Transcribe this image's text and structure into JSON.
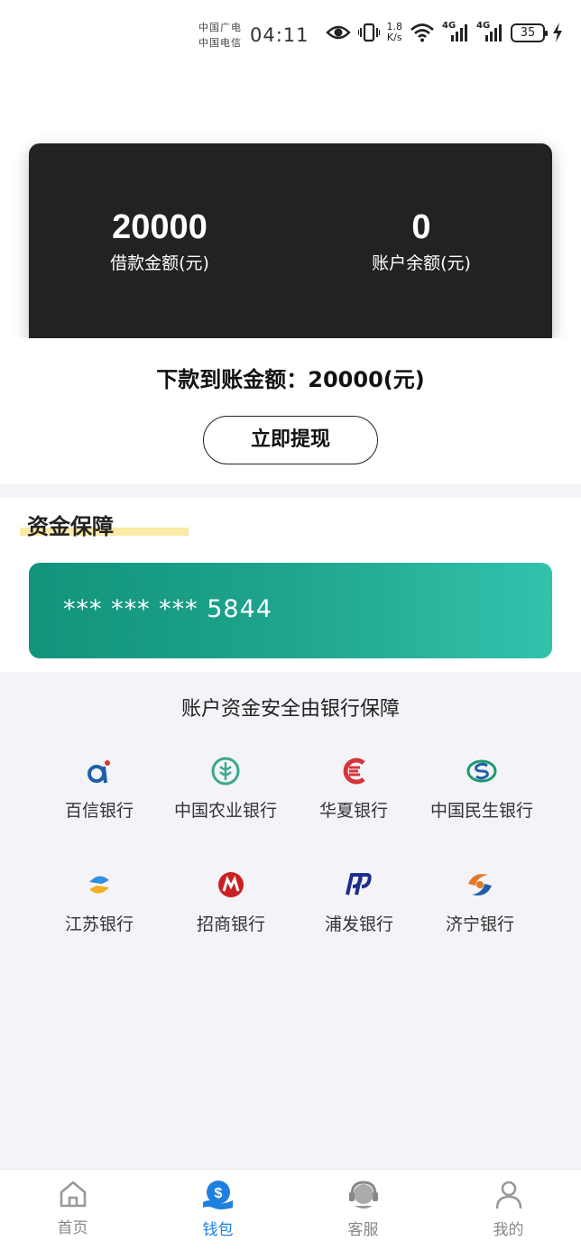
{
  "status_bar": {
    "carrier_1": "中国广电",
    "carrier_2": "中国电信",
    "time": "04:11",
    "net_speed_value": "1.8",
    "net_speed_unit": "K/s",
    "signal_1_label": "4G",
    "signal_2_label": "4G",
    "battery": "35",
    "icons": [
      "eye-icon",
      "vibrate-icon",
      "wifi-icon",
      "signal-icon",
      "signal-icon",
      "battery-icon",
      "charging-icon"
    ]
  },
  "summary": {
    "loan_amount": "20000",
    "loan_amount_label": "借款金额(元)",
    "balance": "0",
    "balance_label": "账户余额(元)"
  },
  "disbursement": {
    "text": "下款到账金额：20000(元)",
    "withdraw_button": "立即提现"
  },
  "fund_protection": {
    "title": "资金保障",
    "card_number": "*** *** *** 5844",
    "guarantee_text": "账户资金安全由银行保障"
  },
  "banks": [
    {
      "name": "百信银行",
      "icon": "aibank-logo-icon",
      "color": "#1f5fa8"
    },
    {
      "name": "中国农业银行",
      "icon": "abc-logo-icon",
      "color": "#3aa88d"
    },
    {
      "name": "华夏银行",
      "icon": "hxb-logo-icon",
      "color": "#d8343a"
    },
    {
      "name": "中国民生银行",
      "icon": "cmbc-logo-icon",
      "color": "#1a9a6e"
    },
    {
      "name": "江苏银行",
      "icon": "jsb-logo-icon",
      "color": "#2f8fe0"
    },
    {
      "name": "招商银行",
      "icon": "cmb-logo-icon",
      "color": "#c92026"
    },
    {
      "name": "浦发银行",
      "icon": "spdb-logo-icon",
      "color": "#1f2e8c"
    },
    {
      "name": "济宁银行",
      "icon": "jnb-logo-icon",
      "color": "#e07a2a"
    }
  ],
  "tabbar": {
    "tabs": [
      {
        "label": "首页",
        "icon": "home-icon"
      },
      {
        "label": "钱包",
        "icon": "wallet-icon"
      },
      {
        "label": "客服",
        "icon": "support-icon"
      },
      {
        "label": "我的",
        "icon": "profile-icon"
      }
    ],
    "active_tab": "钱包",
    "active_color": "#1e7fe0"
  }
}
